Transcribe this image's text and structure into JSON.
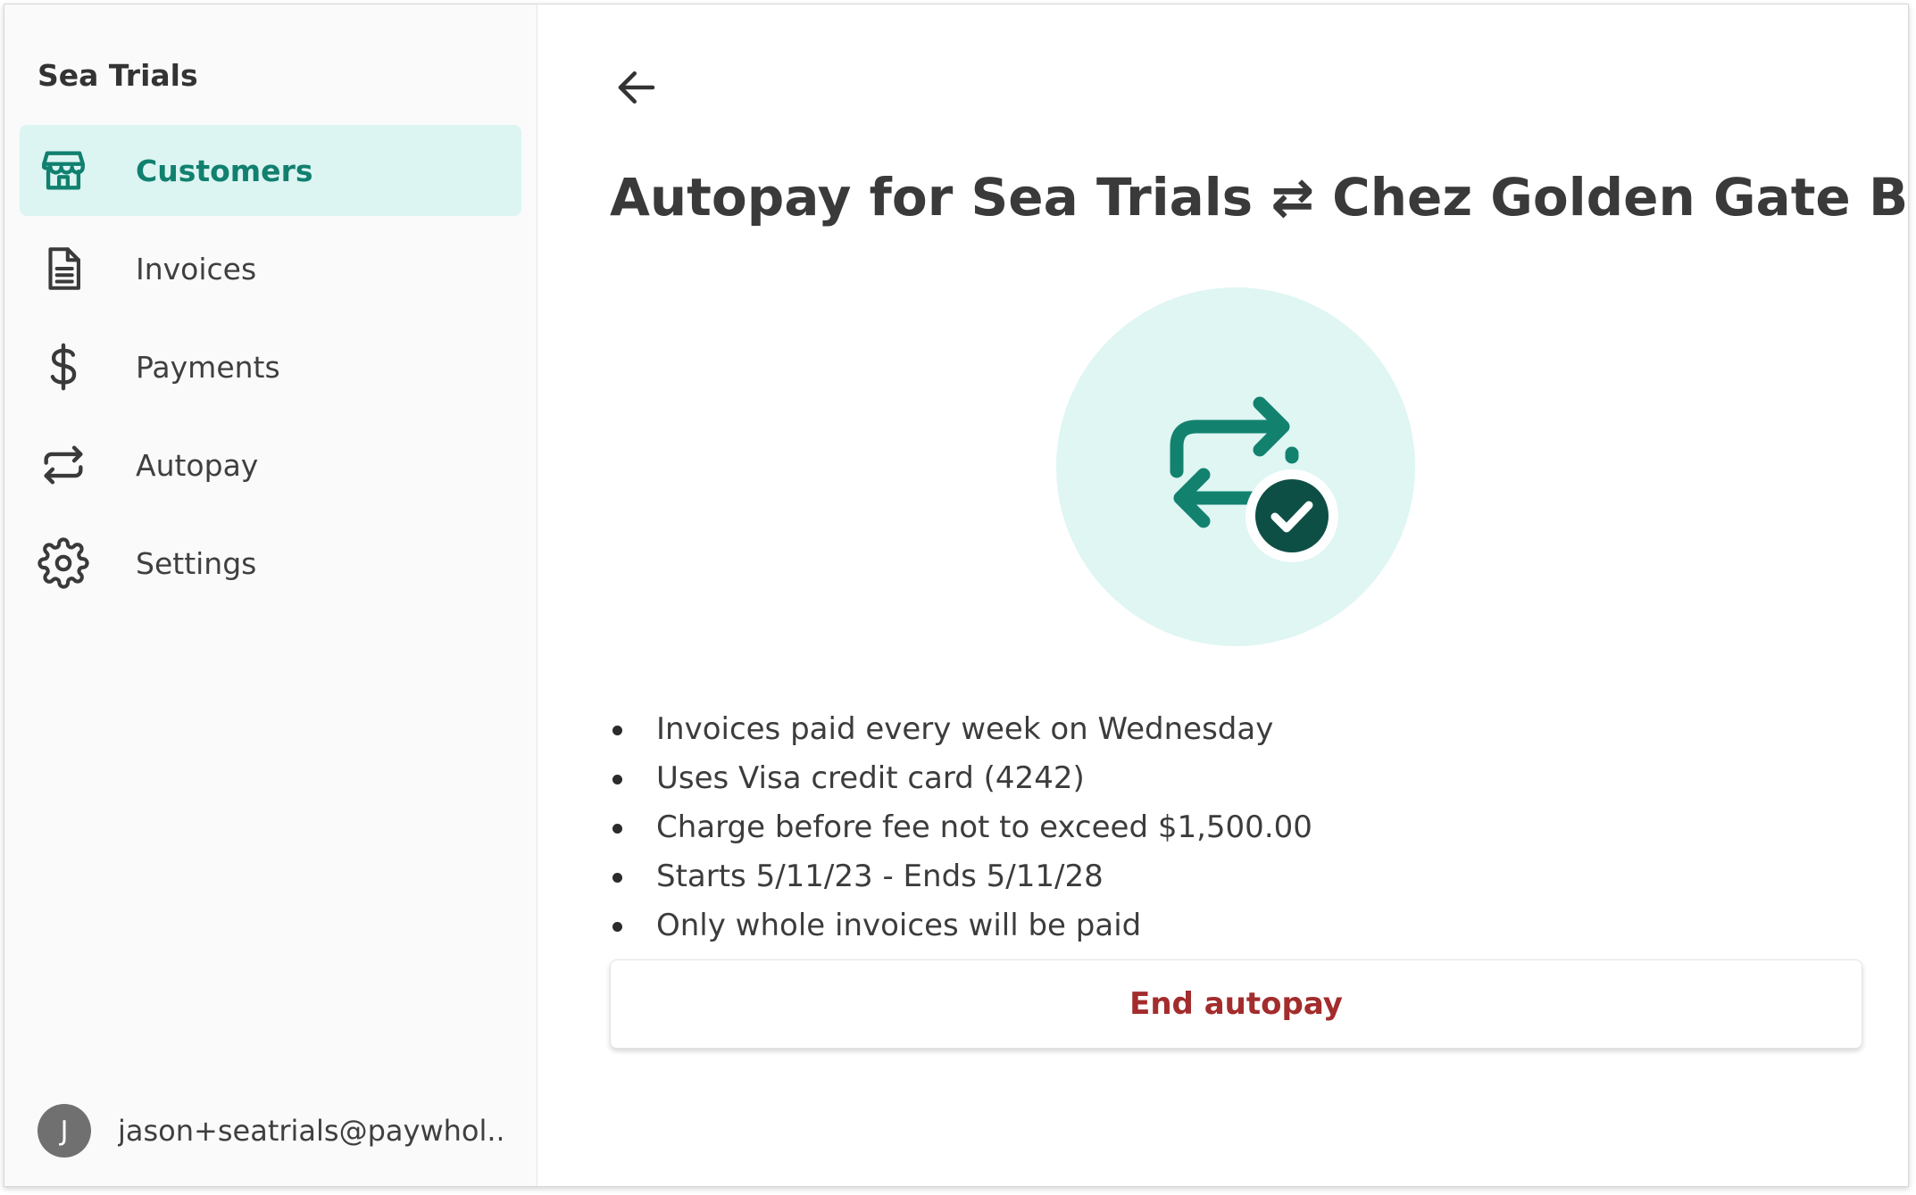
{
  "app": {
    "brand": "Sea Trials"
  },
  "sidebar": {
    "items": [
      {
        "label": "Customers",
        "icon": "storefront-icon",
        "active": true
      },
      {
        "label": "Invoices",
        "icon": "document-icon",
        "active": false
      },
      {
        "label": "Payments",
        "icon": "dollar-icon",
        "active": false
      },
      {
        "label": "Autopay",
        "icon": "repeat-arrows-icon",
        "active": false
      },
      {
        "label": "Settings",
        "icon": "gear-icon",
        "active": false
      }
    ],
    "user": {
      "initial": "J",
      "email": "jason+seatrials@paywhol..."
    }
  },
  "main": {
    "title": "Autopay for Sea Trials ⇄ Chez Golden Gate Bakery",
    "hero_icon": "autopay-active-icon",
    "details": [
      "Invoices paid every week on Wednesday",
      "Uses Visa credit card (4242)",
      "Charge before fee not to exceed $1,500.00",
      "Starts 5/11/23 - Ends 5/11/28",
      "Only whole invoices will be paid"
    ],
    "end_button_label": "End autopay"
  },
  "colors": {
    "accent": "#11806f",
    "accent_light": "#dcf5f2",
    "danger": "#a32c2c",
    "hero_dark": "#0e4f45"
  }
}
